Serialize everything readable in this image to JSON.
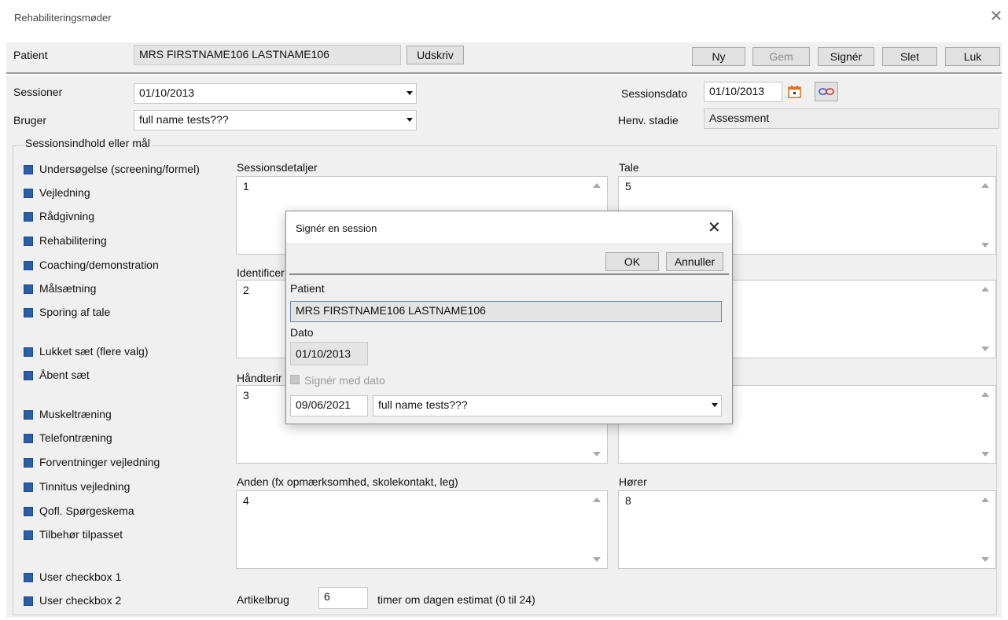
{
  "window": {
    "title": "Rehabiliteringsmøder"
  },
  "toolbar": {
    "patient_label": "Patient",
    "patient_name": "MRS FIRSTNAME106 LASTNAME106",
    "print_button": "Udskriv",
    "new_button": "Ny",
    "save_button": "Gem",
    "sign_button": "Signér",
    "delete_button": "Slet",
    "close_button": "Luk"
  },
  "form": {
    "sessions_label": "Sessioner",
    "sessions_value": "01/10/2013",
    "user_label": "Bruger",
    "user_value": "full name tests???",
    "session_date_label": "Sessionsdato",
    "session_date_value": "01/10/2013",
    "referral_stage_label": "Henv. stadie",
    "referral_stage_value": "Assessment"
  },
  "group": {
    "title": "Sessionsindhold eller mål",
    "checkboxes": [
      "Undersøgelse (screening/formel)",
      "Vejledning",
      "Rådgivning",
      "Rehabilitering",
      "Coaching/demonstration",
      "Målsætning",
      "Sporing af tale",
      "Lukket sæt (flere valg)",
      "Åbent sæt",
      "Muskeltræning",
      "Telefontræning",
      "Forventninger vejledning",
      "Tinnitus vejledning",
      "Qofl. Spørgeskema",
      "Tilbehør tilpasset",
      "User checkbox 1",
      "User checkbox 2"
    ]
  },
  "panels": {
    "session_details": {
      "label": "Sessionsdetaljer",
      "value": "1"
    },
    "identification": {
      "label": "Identificer",
      "value": "2"
    },
    "handling": {
      "label": "Håndterir",
      "value": "3"
    },
    "other": {
      "label": "Anden (fx opmærksomhed, skolekontakt, leg)",
      "value": "4"
    },
    "speech": {
      "label": "Tale",
      "value": "5"
    },
    "right2": {
      "value": ""
    },
    "right3": {
      "value": ""
    },
    "listener": {
      "label": "Hører",
      "value": "8"
    }
  },
  "article_use": {
    "label": "Artikelbrug",
    "value": "6",
    "suffix": "timer om dagen estimat (0 til 24)"
  },
  "dialog": {
    "title": "Signér en session",
    "ok_button": "OK",
    "cancel_button": "Annuller",
    "patient_label": "Patient",
    "patient_value": "MRS FIRSTNAME106 LASTNAME106",
    "date_label": "Dato",
    "date_value": "01/10/2013",
    "sign_with_date_label": "Signér med dato",
    "sign_date_value": "09/06/2021",
    "signer_value": "full name tests???"
  }
}
